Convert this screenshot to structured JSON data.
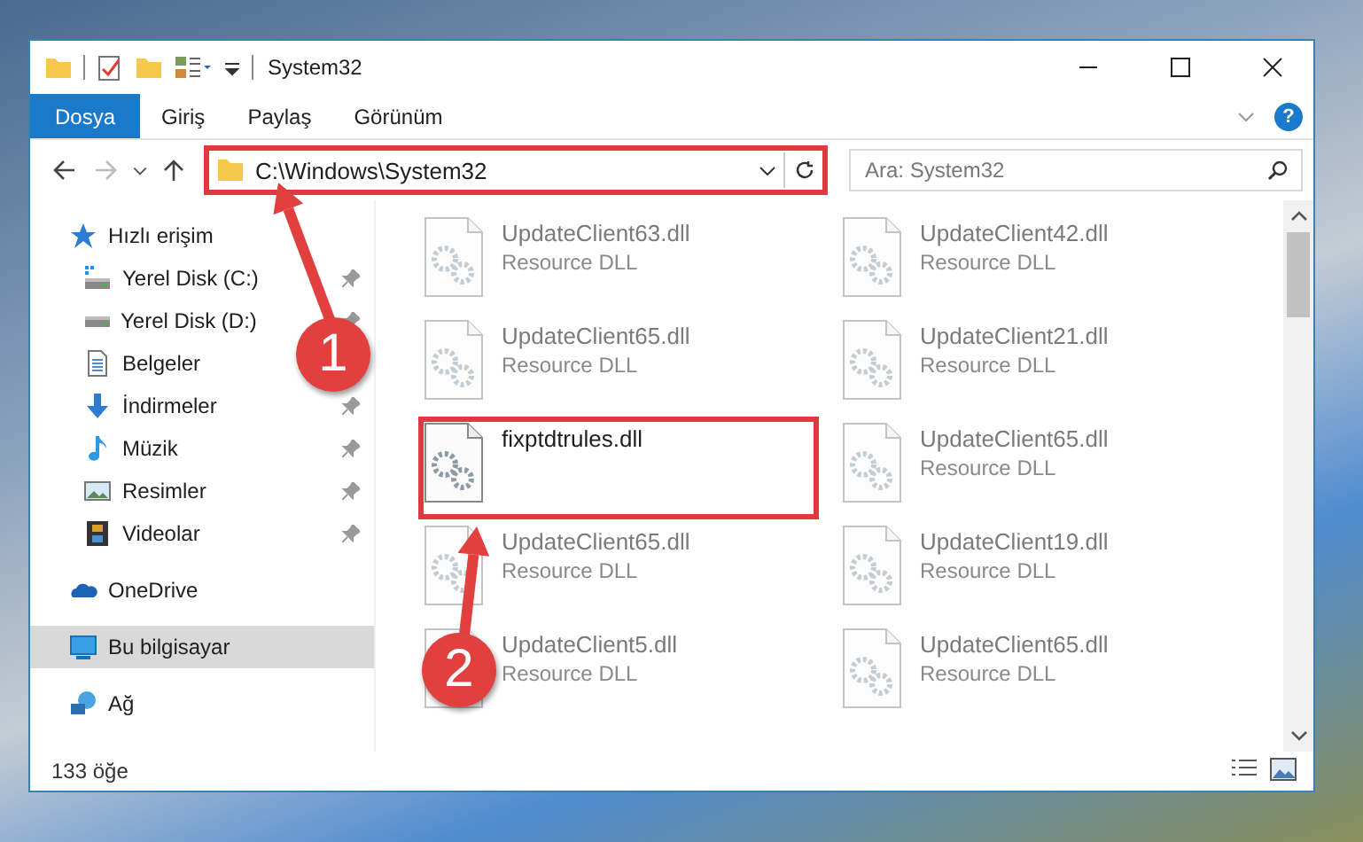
{
  "window": {
    "title": "System32"
  },
  "ribbon": {
    "tabs": [
      {
        "label": "Dosya",
        "selected": true
      },
      {
        "label": "Giriş",
        "selected": false
      },
      {
        "label": "Paylaş",
        "selected": false
      },
      {
        "label": "Görünüm",
        "selected": false
      }
    ],
    "help_button": "?"
  },
  "address_bar": {
    "path": "C:\\Windows\\System32",
    "highlighted": true
  },
  "search": {
    "placeholder": "Ara: System32"
  },
  "sidebar": {
    "items": [
      {
        "label": "Hızlı erişim",
        "kind": "quick-access",
        "selected": false,
        "children": [
          {
            "label": "Yerel Disk (C:)",
            "kind": "system-drive",
            "selected": false,
            "pinned": true
          },
          {
            "label": "Yerel Disk (D:)",
            "kind": "drive",
            "selected": false,
            "pinned": true
          },
          {
            "label": "Belgeler",
            "kind": "documents",
            "selected": false,
            "pinned": false
          },
          {
            "label": "İndirmeler",
            "kind": "downloads",
            "selected": false,
            "pinned": true
          },
          {
            "label": "Müzik",
            "kind": "music",
            "selected": false,
            "pinned": true
          },
          {
            "label": "Resimler",
            "kind": "pictures",
            "selected": false,
            "pinned": true
          },
          {
            "label": "Videolar",
            "kind": "videos",
            "selected": false,
            "pinned": true
          }
        ]
      },
      {
        "label": "OneDrive",
        "kind": "cloud",
        "selected": false
      },
      {
        "label": "Bu bilgisayar",
        "kind": "computer",
        "selected": true
      },
      {
        "label": "Ağ",
        "kind": "network",
        "selected": false
      }
    ]
  },
  "files": [
    {
      "name": "UpdateClient63.dll",
      "type": "Resource DLL",
      "blurred": true,
      "highlighted": false
    },
    {
      "name": "UpdateClient42.dll",
      "type": "Resource DLL",
      "blurred": true,
      "highlighted": false
    },
    {
      "name": "UpdateClient65.dll",
      "type": "Resource DLL",
      "blurred": true,
      "highlighted": false
    },
    {
      "name": "UpdateClient21.dll",
      "type": "Resource DLL",
      "blurred": true,
      "highlighted": false
    },
    {
      "name": "fixptdtrules.dll",
      "blurred": false,
      "highlighted": true
    },
    {
      "name": "UpdateClient65.dll",
      "type": "Resource DLL",
      "blurred": true,
      "highlighted": false
    },
    {
      "name": "UpdateClient65.dll",
      "type": "Resource DLL",
      "blurred": true,
      "highlighted": false
    },
    {
      "name": "UpdateClient19.dll",
      "type": "Resource DLL",
      "blurred": true,
      "highlighted": false
    },
    {
      "name": "UpdateClient5.dll",
      "type": "Resource DLL",
      "blurred": true,
      "highlighted": false
    },
    {
      "name": "UpdateClient65.dll",
      "type": "Resource DLL",
      "blurred": true,
      "highlighted": false
    }
  ],
  "status_bar": {
    "item_count": "133 öğe"
  },
  "callouts": [
    {
      "number": "1"
    },
    {
      "number": "2"
    }
  ]
}
